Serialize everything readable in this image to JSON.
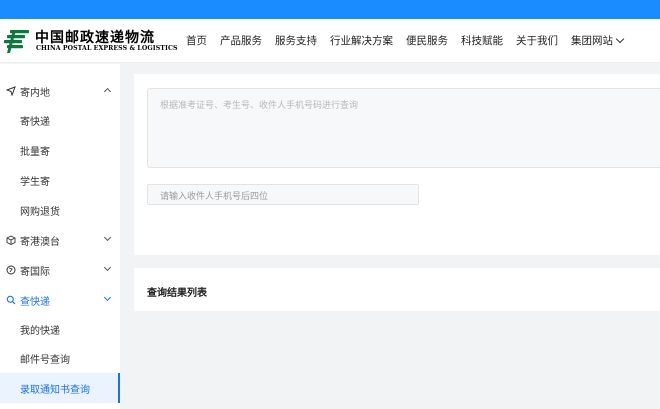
{
  "brand": {
    "name_cn": "中国邮政速递物流",
    "name_en": "CHINA POSTAL EXPRESS & LOGISTICS",
    "colors": {
      "topbar": "#1a8cff",
      "logo_green": "#0a7a3a",
      "accent_blue": "#1a73e8"
    }
  },
  "nav": {
    "items": [
      "首页",
      "产品服务",
      "服务支持",
      "行业解决方案",
      "便民服务",
      "科技赋能",
      "关于我们"
    ],
    "group_site": "集团网站"
  },
  "sidebar": {
    "groups": [
      {
        "label": "寄内地",
        "icon": "send-icon",
        "expanded": true
      },
      {
        "label": "寄港澳台",
        "icon": "box-icon",
        "expanded": false
      },
      {
        "label": "寄国际",
        "icon": "globe-icon",
        "expanded": false
      },
      {
        "label": "查快递",
        "icon": "search-icon",
        "expanded": true
      }
    ],
    "sub_mainland": [
      "寄快递",
      "批量寄",
      "学生寄",
      "网购退货"
    ],
    "sub_track": [
      "我的快递",
      "邮件号查询",
      "录取通知书查询"
    ]
  },
  "query": {
    "textarea_placeholder": "根据准考证号、考生号、收件人手机号码进行查询",
    "phone_placeholder": "请输入收件人手机号后四位"
  },
  "results": {
    "title": "查询结果列表"
  }
}
